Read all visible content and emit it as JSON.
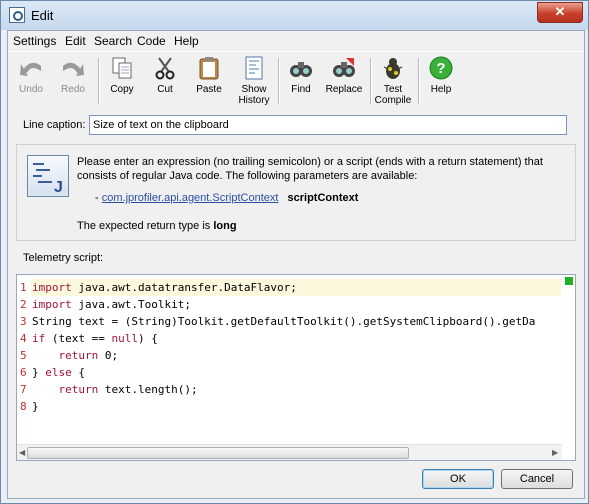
{
  "window": {
    "title": "Edit",
    "close_glyph": "✕"
  },
  "menu": [
    "Settings",
    "Edit",
    "Search",
    "Code",
    "Help"
  ],
  "toolbar": {
    "undo": "Undo",
    "redo": "Redo",
    "copy": "Copy",
    "cut": "Cut",
    "paste": "Paste",
    "show_history_1": "Show",
    "show_history_2": "History",
    "find": "Find",
    "replace": "Replace",
    "test_compile_1": "Test",
    "test_compile_2": "Compile",
    "help": "Help"
  },
  "caption": {
    "label": "Line caption:",
    "value": "Size of text on the clipboard"
  },
  "info": {
    "text": "Please enter an expression (no trailing semicolon) or a script (ends with a return statement) that consists of regular Java code. The following parameters are available:",
    "param_dash": "-",
    "param_class": "com.jprofiler.api.agent.ScriptContext",
    "param_name": "scriptContext",
    "return_prefix": "The expected return type is",
    "return_type": "long"
  },
  "editor": {
    "label": "Telemetry script:",
    "lines": [
      {
        "n": "1",
        "kw": "import",
        "rest": " java.awt.datatransfer.DataFlavor;"
      },
      {
        "n": "2",
        "kw": "import",
        "rest": " java.awt.Toolkit;"
      },
      {
        "n": "3",
        "kw": "",
        "rest": "String text = (String)Toolkit.getDefaultToolkit().getSystemClipboard().getDa"
      },
      {
        "n": "4",
        "kw": "if",
        "rest": " (text == null) {",
        "post_kw": "null"
      },
      {
        "n": "5",
        "kw": "",
        "rest": "    return 0;",
        "inner_kw": "return"
      },
      {
        "n": "6",
        "kw": "",
        "rest": "} else {",
        "inner_kw": "else"
      },
      {
        "n": "7",
        "kw": "",
        "rest": "    return text.length();",
        "inner_kw": "return"
      },
      {
        "n": "8",
        "kw": "",
        "rest": "}"
      }
    ]
  },
  "buttons": {
    "ok": "OK",
    "cancel": "Cancel"
  },
  "colors": {
    "keyword": "#a0143c",
    "line_number": "#c0302b",
    "link": "#2a4fa0",
    "highlight_line": "#fbf8dd"
  }
}
